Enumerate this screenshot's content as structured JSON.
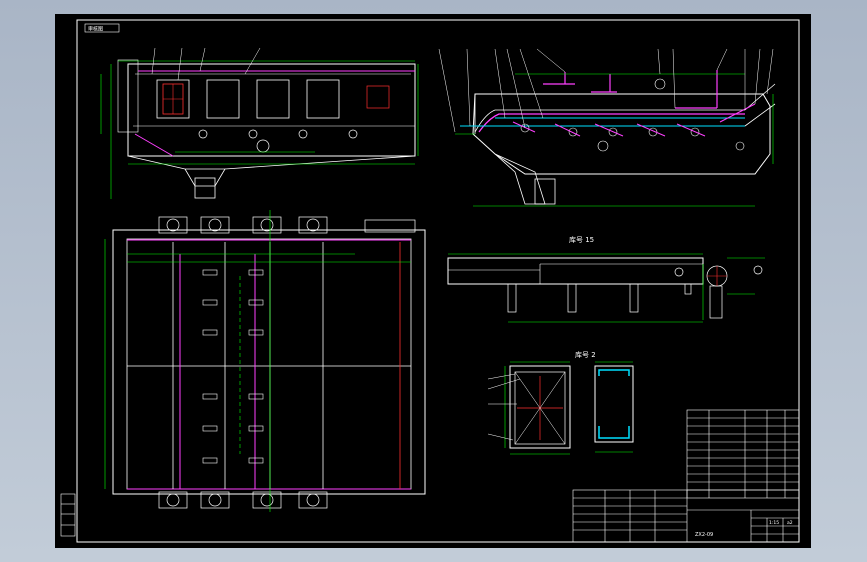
{
  "drawing": {
    "section_labels": {
      "section_15": "库号 15",
      "section_2": "库号 2"
    },
    "stamp_top_left": "审核图",
    "title_block": {
      "drawing_code": "ZX2-09",
      "scale": "1:15",
      "sheet_no": "a2"
    }
  }
}
